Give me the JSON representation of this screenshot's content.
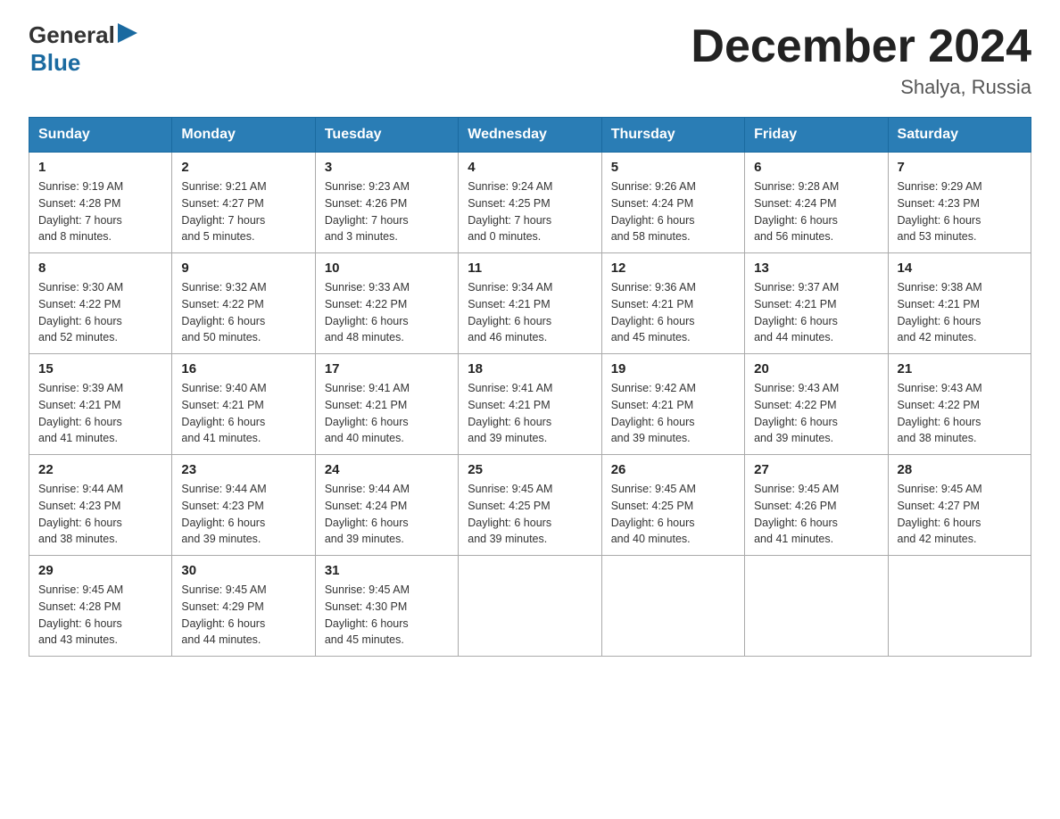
{
  "header": {
    "logo_general": "General",
    "logo_blue": "Blue",
    "month_title": "December 2024",
    "location": "Shalya, Russia"
  },
  "days_of_week": [
    "Sunday",
    "Monday",
    "Tuesday",
    "Wednesday",
    "Thursday",
    "Friday",
    "Saturday"
  ],
  "weeks": [
    [
      {
        "day": "1",
        "sunrise": "Sunrise: 9:19 AM",
        "sunset": "Sunset: 4:28 PM",
        "daylight": "Daylight: 7 hours",
        "minutes": "and 8 minutes."
      },
      {
        "day": "2",
        "sunrise": "Sunrise: 9:21 AM",
        "sunset": "Sunset: 4:27 PM",
        "daylight": "Daylight: 7 hours",
        "minutes": "and 5 minutes."
      },
      {
        "day": "3",
        "sunrise": "Sunrise: 9:23 AM",
        "sunset": "Sunset: 4:26 PM",
        "daylight": "Daylight: 7 hours",
        "minutes": "and 3 minutes."
      },
      {
        "day": "4",
        "sunrise": "Sunrise: 9:24 AM",
        "sunset": "Sunset: 4:25 PM",
        "daylight": "Daylight: 7 hours",
        "minutes": "and 0 minutes."
      },
      {
        "day": "5",
        "sunrise": "Sunrise: 9:26 AM",
        "sunset": "Sunset: 4:24 PM",
        "daylight": "Daylight: 6 hours",
        "minutes": "and 58 minutes."
      },
      {
        "day": "6",
        "sunrise": "Sunrise: 9:28 AM",
        "sunset": "Sunset: 4:24 PM",
        "daylight": "Daylight: 6 hours",
        "minutes": "and 56 minutes."
      },
      {
        "day": "7",
        "sunrise": "Sunrise: 9:29 AM",
        "sunset": "Sunset: 4:23 PM",
        "daylight": "Daylight: 6 hours",
        "minutes": "and 53 minutes."
      }
    ],
    [
      {
        "day": "8",
        "sunrise": "Sunrise: 9:30 AM",
        "sunset": "Sunset: 4:22 PM",
        "daylight": "Daylight: 6 hours",
        "minutes": "and 52 minutes."
      },
      {
        "day": "9",
        "sunrise": "Sunrise: 9:32 AM",
        "sunset": "Sunset: 4:22 PM",
        "daylight": "Daylight: 6 hours",
        "minutes": "and 50 minutes."
      },
      {
        "day": "10",
        "sunrise": "Sunrise: 9:33 AM",
        "sunset": "Sunset: 4:22 PM",
        "daylight": "Daylight: 6 hours",
        "minutes": "and 48 minutes."
      },
      {
        "day": "11",
        "sunrise": "Sunrise: 9:34 AM",
        "sunset": "Sunset: 4:21 PM",
        "daylight": "Daylight: 6 hours",
        "minutes": "and 46 minutes."
      },
      {
        "day": "12",
        "sunrise": "Sunrise: 9:36 AM",
        "sunset": "Sunset: 4:21 PM",
        "daylight": "Daylight: 6 hours",
        "minutes": "and 45 minutes."
      },
      {
        "day": "13",
        "sunrise": "Sunrise: 9:37 AM",
        "sunset": "Sunset: 4:21 PM",
        "daylight": "Daylight: 6 hours",
        "minutes": "and 44 minutes."
      },
      {
        "day": "14",
        "sunrise": "Sunrise: 9:38 AM",
        "sunset": "Sunset: 4:21 PM",
        "daylight": "Daylight: 6 hours",
        "minutes": "and 42 minutes."
      }
    ],
    [
      {
        "day": "15",
        "sunrise": "Sunrise: 9:39 AM",
        "sunset": "Sunset: 4:21 PM",
        "daylight": "Daylight: 6 hours",
        "minutes": "and 41 minutes."
      },
      {
        "day": "16",
        "sunrise": "Sunrise: 9:40 AM",
        "sunset": "Sunset: 4:21 PM",
        "daylight": "Daylight: 6 hours",
        "minutes": "and 41 minutes."
      },
      {
        "day": "17",
        "sunrise": "Sunrise: 9:41 AM",
        "sunset": "Sunset: 4:21 PM",
        "daylight": "Daylight: 6 hours",
        "minutes": "and 40 minutes."
      },
      {
        "day": "18",
        "sunrise": "Sunrise: 9:41 AM",
        "sunset": "Sunset: 4:21 PM",
        "daylight": "Daylight: 6 hours",
        "minutes": "and 39 minutes."
      },
      {
        "day": "19",
        "sunrise": "Sunrise: 9:42 AM",
        "sunset": "Sunset: 4:21 PM",
        "daylight": "Daylight: 6 hours",
        "minutes": "and 39 minutes."
      },
      {
        "day": "20",
        "sunrise": "Sunrise: 9:43 AM",
        "sunset": "Sunset: 4:22 PM",
        "daylight": "Daylight: 6 hours",
        "minutes": "and 39 minutes."
      },
      {
        "day": "21",
        "sunrise": "Sunrise: 9:43 AM",
        "sunset": "Sunset: 4:22 PM",
        "daylight": "Daylight: 6 hours",
        "minutes": "and 38 minutes."
      }
    ],
    [
      {
        "day": "22",
        "sunrise": "Sunrise: 9:44 AM",
        "sunset": "Sunset: 4:23 PM",
        "daylight": "Daylight: 6 hours",
        "minutes": "and 38 minutes."
      },
      {
        "day": "23",
        "sunrise": "Sunrise: 9:44 AM",
        "sunset": "Sunset: 4:23 PM",
        "daylight": "Daylight: 6 hours",
        "minutes": "and 39 minutes."
      },
      {
        "day": "24",
        "sunrise": "Sunrise: 9:44 AM",
        "sunset": "Sunset: 4:24 PM",
        "daylight": "Daylight: 6 hours",
        "minutes": "and 39 minutes."
      },
      {
        "day": "25",
        "sunrise": "Sunrise: 9:45 AM",
        "sunset": "Sunset: 4:25 PM",
        "daylight": "Daylight: 6 hours",
        "minutes": "and 39 minutes."
      },
      {
        "day": "26",
        "sunrise": "Sunrise: 9:45 AM",
        "sunset": "Sunset: 4:25 PM",
        "daylight": "Daylight: 6 hours",
        "minutes": "and 40 minutes."
      },
      {
        "day": "27",
        "sunrise": "Sunrise: 9:45 AM",
        "sunset": "Sunset: 4:26 PM",
        "daylight": "Daylight: 6 hours",
        "minutes": "and 41 minutes."
      },
      {
        "day": "28",
        "sunrise": "Sunrise: 9:45 AM",
        "sunset": "Sunset: 4:27 PM",
        "daylight": "Daylight: 6 hours",
        "minutes": "and 42 minutes."
      }
    ],
    [
      {
        "day": "29",
        "sunrise": "Sunrise: 9:45 AM",
        "sunset": "Sunset: 4:28 PM",
        "daylight": "Daylight: 6 hours",
        "minutes": "and 43 minutes."
      },
      {
        "day": "30",
        "sunrise": "Sunrise: 9:45 AM",
        "sunset": "Sunset: 4:29 PM",
        "daylight": "Daylight: 6 hours",
        "minutes": "and 44 minutes."
      },
      {
        "day": "31",
        "sunrise": "Sunrise: 9:45 AM",
        "sunset": "Sunset: 4:30 PM",
        "daylight": "Daylight: 6 hours",
        "minutes": "and 45 minutes."
      },
      null,
      null,
      null,
      null
    ]
  ],
  "colors": {
    "header_bg": "#2a7db5",
    "header_text": "#ffffff",
    "border": "#aaaaaa",
    "accent": "#1a6aa0"
  }
}
